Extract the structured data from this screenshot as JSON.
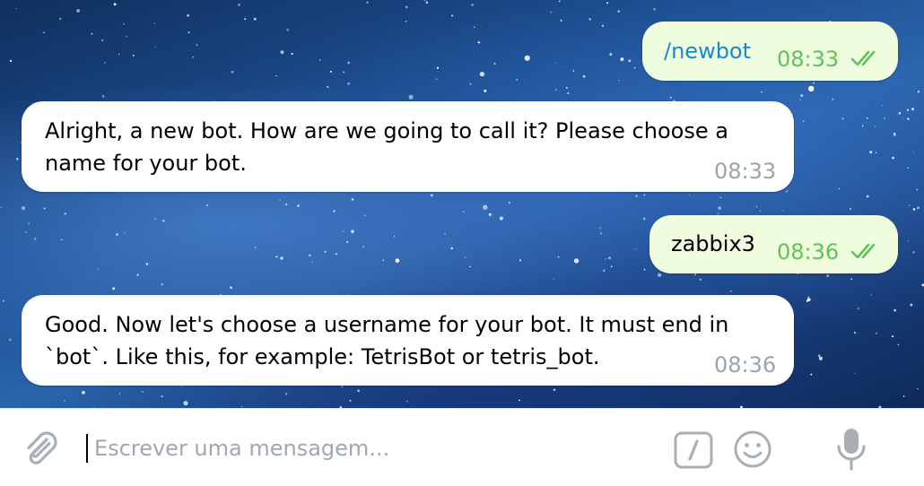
{
  "messages": [
    {
      "direction": "outgoing",
      "text": "/newbot",
      "time": "08:33",
      "status": "read"
    },
    {
      "direction": "incoming",
      "lines": [
        "Alright, a new bot. How are we going to call it? Please choose a",
        "name for your bot."
      ],
      "time": "08:33"
    },
    {
      "direction": "outgoing",
      "text": "zabbix3",
      "time": "08:36",
      "status": "read"
    },
    {
      "direction": "incoming",
      "lines": [
        "Good. Now let's choose a username for your bot. It must end in",
        "`bot`. Like this, for example: TetrisBot or tetris_bot."
      ],
      "time": "08:36"
    }
  ],
  "input": {
    "placeholder": "Escrever uma mensagem..."
  },
  "icons": {
    "attach": "paperclip-icon",
    "commands": "slash-commands-icon",
    "emoji": "smiley-icon",
    "voice": "microphone-icon",
    "read_status": "double-check-icon"
  },
  "colors": {
    "outgoing_bubble": "#effdde",
    "incoming_bubble": "#ffffff",
    "command_link": "#168acd",
    "outgoing_time": "#5fc35a",
    "incoming_time": "#9aa4ad",
    "input_icon": "#a8afb5"
  }
}
